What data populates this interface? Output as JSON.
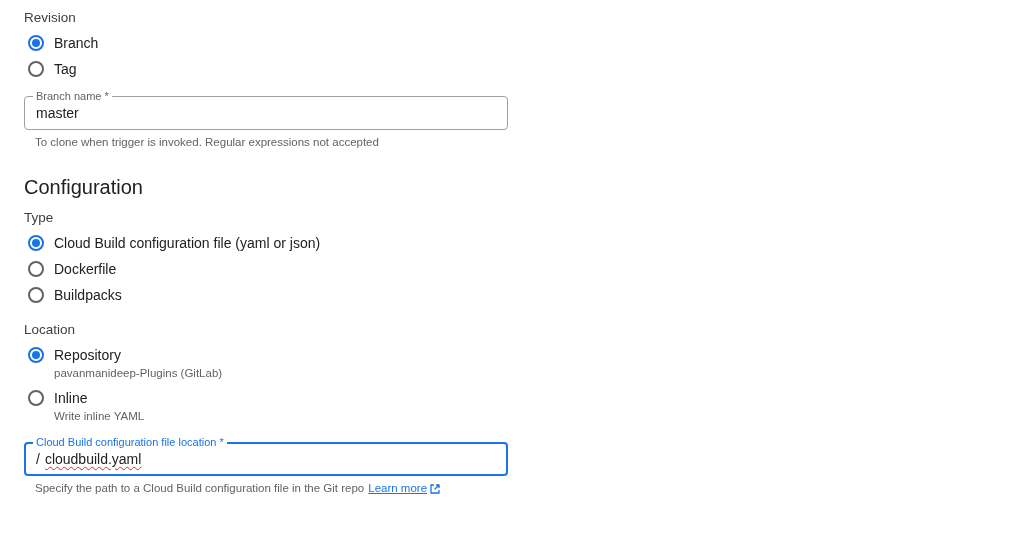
{
  "sections": [
    {
      "kind": "group",
      "label": "Revision",
      "options": [
        {
          "label": "Branch",
          "selected": true
        },
        {
          "label": "Tag",
          "selected": false
        }
      ]
    },
    {
      "kind": "field",
      "label": "Branch name *",
      "value": "master",
      "focused": false,
      "misspelled": false,
      "helper": "To clone when trigger is invoked. Regular expressions not accepted"
    },
    {
      "kind": "heading",
      "label": "Configuration"
    },
    {
      "kind": "group",
      "label": "Type",
      "options": [
        {
          "label": "Cloud Build configuration file (yaml or json)",
          "selected": true
        },
        {
          "label": "Dockerfile",
          "selected": false
        },
        {
          "label": "Buildpacks",
          "selected": false
        }
      ]
    },
    {
      "kind": "group",
      "label": "Location",
      "options": [
        {
          "label": "Repository",
          "sub": "pavanmanideep-Plugins (GitLab)",
          "selected": true
        },
        {
          "label": "Inline",
          "sub": "Write inline YAML",
          "selected": false
        }
      ]
    },
    {
      "kind": "field",
      "label": "Cloud Build configuration file location *",
      "prefix": "/",
      "value": "cloudbuild.yaml",
      "focused": true,
      "misspelled": true,
      "helper": "Specify the path to a Cloud Build configuration file in the Git repo",
      "link": "Learn more"
    }
  ]
}
